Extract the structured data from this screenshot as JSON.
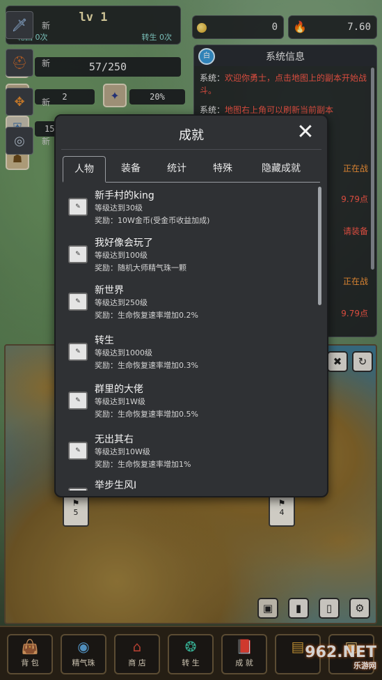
{
  "header": {
    "level": "lv 1",
    "lunhui": "轮回 0次",
    "zhuansheng": "转生 0次",
    "gold": "0",
    "fire": "7.60"
  },
  "stats": {
    "hp": "57/250",
    "attack": "2",
    "crit": "20%",
    "defense": "15"
  },
  "equipment": [
    {
      "label": "新"
    },
    {
      "label": "新"
    },
    {
      "label": "新"
    },
    {
      "label": "新"
    }
  ],
  "system_info": {
    "title": "系统信息",
    "messages": [
      {
        "prefix": "系统：",
        "text": "欢迎你勇士，点击地图上的副本开始战斗。"
      },
      {
        "prefix": "系统：",
        "text": "地图右上角可以刷新当前副本"
      }
    ],
    "side_lines": [
      "正在战",
      "9.79点",
      "请装备",
      "正在战",
      "9.79点"
    ]
  },
  "modal": {
    "title": "成就",
    "tabs": [
      "人物",
      "装备",
      "统计",
      "特殊",
      "隐藏成就"
    ],
    "active_tab": "人物",
    "items": [
      {
        "name": "新手村的king",
        "cond": "等级达到30级",
        "reward": "奖励：10W金币(受金币收益加成)"
      },
      {
        "name": "我好像会玩了",
        "cond": "等级达到100级",
        "reward": "奖励：随机大师精气珠一颗"
      },
      {
        "name": "新世界",
        "cond": "等级达到250级",
        "reward": "奖励：生命恢复速率增加0.2%"
      },
      {
        "name": "转生",
        "cond": "等级达到1000级",
        "reward": "奖励：生命恢复速率增加0.3%"
      },
      {
        "name": "群里的大佬",
        "cond": "等级达到1W级",
        "reward": "奖励：生命恢复速率增加0.5%"
      },
      {
        "name": "无出其右",
        "cond": "等级达到10W级",
        "reward": "奖励：生命恢复速率增加1%"
      },
      {
        "name": "举步生风I",
        "cond": "",
        "reward": ""
      }
    ]
  },
  "map": {
    "flags": [
      {
        "num": "5"
      },
      {
        "num": "4"
      }
    ]
  },
  "nav": {
    "items": [
      {
        "label": "背 包",
        "icon": "bag-icon"
      },
      {
        "label": "精气珠",
        "icon": "orb-icon"
      },
      {
        "label": "商 店",
        "icon": "shop-icon"
      },
      {
        "label": "转 生",
        "icon": "rebirth-icon"
      },
      {
        "label": "成 就",
        "icon": "achievement-icon"
      }
    ]
  },
  "watermark": {
    "main": "962.NET",
    "sub": "乐游网"
  }
}
